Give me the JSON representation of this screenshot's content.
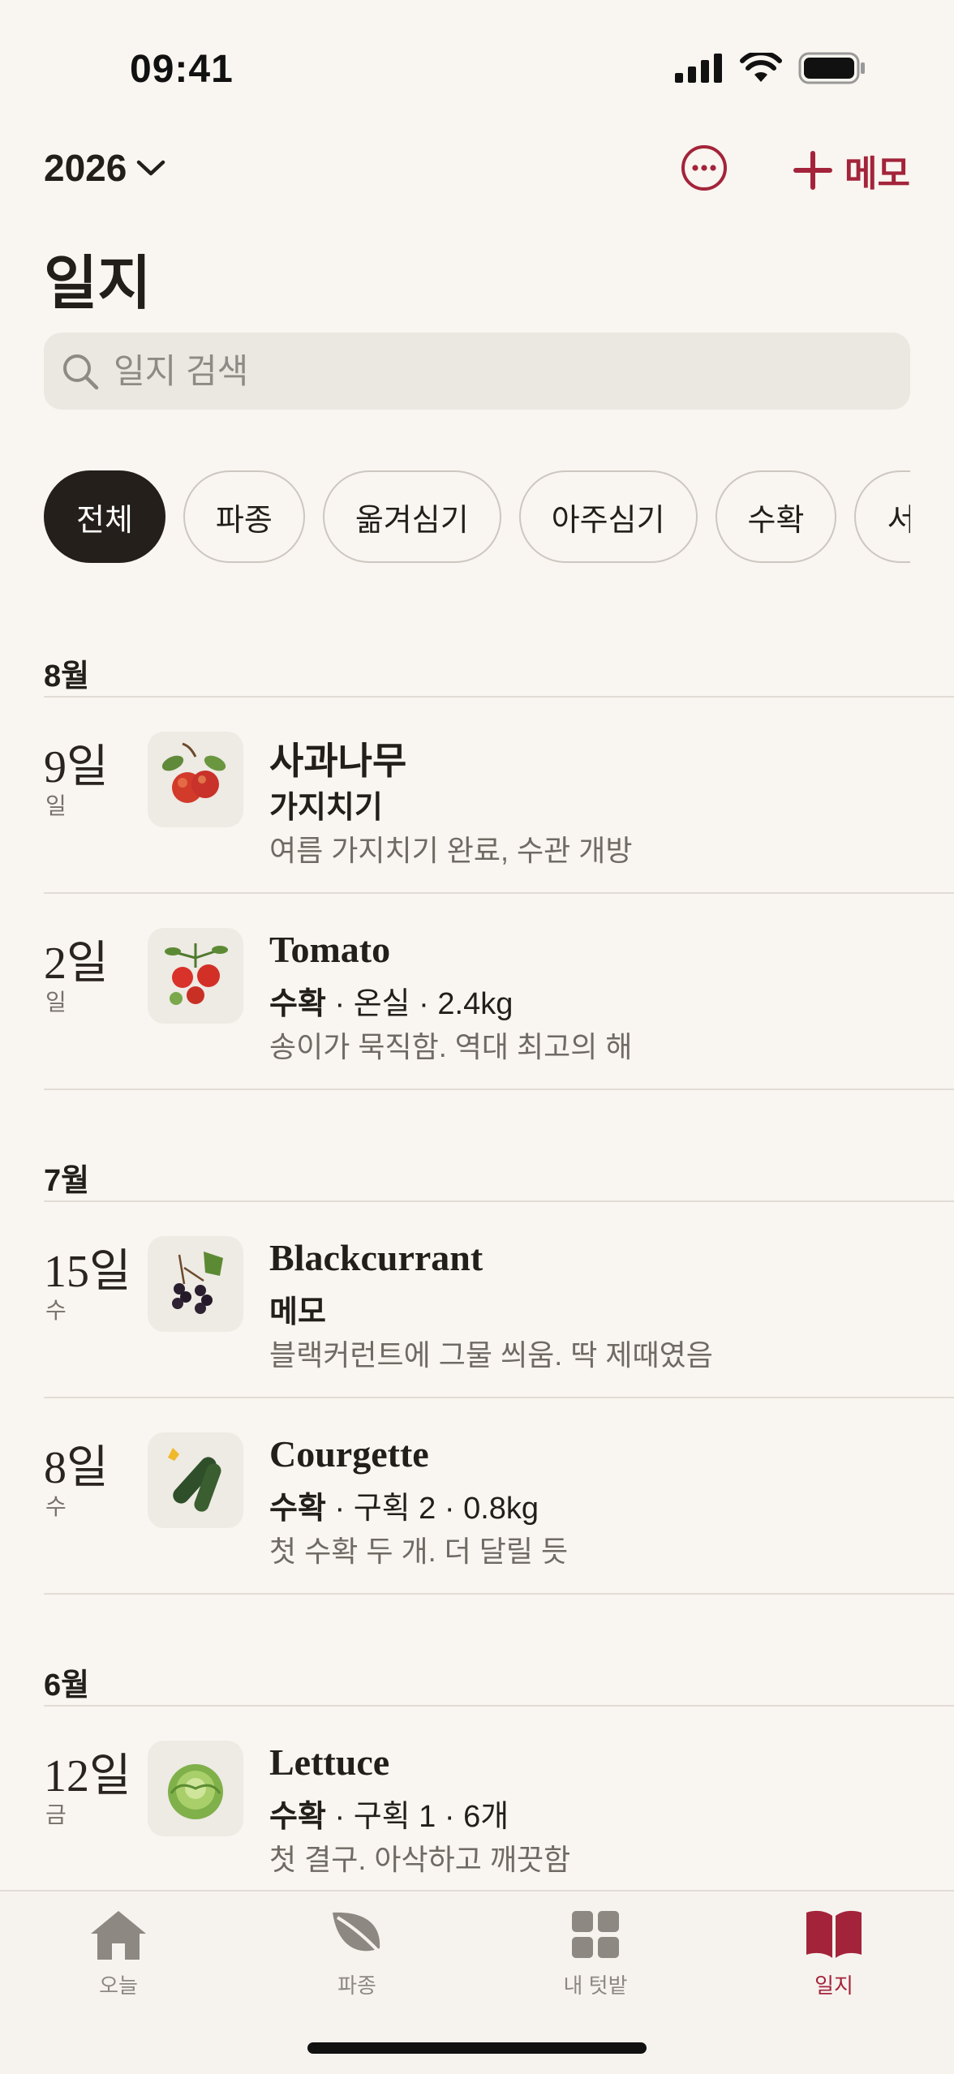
{
  "status": {
    "time": "09:41"
  },
  "header": {
    "year": "2026",
    "add_label": "메모",
    "title": "일지"
  },
  "search": {
    "placeholder": "일지 검색"
  },
  "filters": [
    "전체",
    "파종",
    "옮겨심기",
    "아주심기",
    "수확",
    "서리"
  ],
  "sections": [
    {
      "month": "8월",
      "entries": [
        {
          "day": "9일",
          "weekday": "일",
          "plant": "사과나무",
          "type": "가지치기",
          "details": "",
          "note": "여름 가지치기 완료, 수관 개방",
          "icon": "apple-icon"
        },
        {
          "day": "2일",
          "weekday": "일",
          "plant": "Tomato",
          "type": "수확",
          "details": " · 온실 · 2.4kg",
          "note": "송이가 묵직함. 역대 최고의 해",
          "icon": "tomato-icon"
        }
      ]
    },
    {
      "month": "7월",
      "entries": [
        {
          "day": "15일",
          "weekday": "수",
          "plant": "Blackcurrant",
          "type": "메모",
          "details": "",
          "note": "블랙커런트에 그물 씌움. 딱 제때였음",
          "icon": "blackcurrant-icon"
        },
        {
          "day": "8일",
          "weekday": "수",
          "plant": "Courgette",
          "type": "수확",
          "details": " · 구획 2 · 0.8kg",
          "note": "첫 수확 두 개. 더 달릴 듯",
          "icon": "courgette-icon"
        }
      ]
    },
    {
      "month": "6월",
      "entries": [
        {
          "day": "12일",
          "weekday": "금",
          "plant": "Lettuce",
          "type": "수확",
          "details": " · 구획 1 · 6개",
          "note": "첫 결구. 아삭하고 깨끗함",
          "icon": "lettuce-icon"
        }
      ]
    }
  ],
  "tabs": [
    {
      "label": "오늘",
      "icon": "home-icon"
    },
    {
      "label": "파종",
      "icon": "leaf-icon"
    },
    {
      "label": "내 텃밭",
      "icon": "grid-icon"
    },
    {
      "label": "일지",
      "icon": "book-icon"
    }
  ],
  "colors": {
    "accent": "#a3243a",
    "background": "#f9f5f0",
    "chip_active": "#251f1b"
  }
}
